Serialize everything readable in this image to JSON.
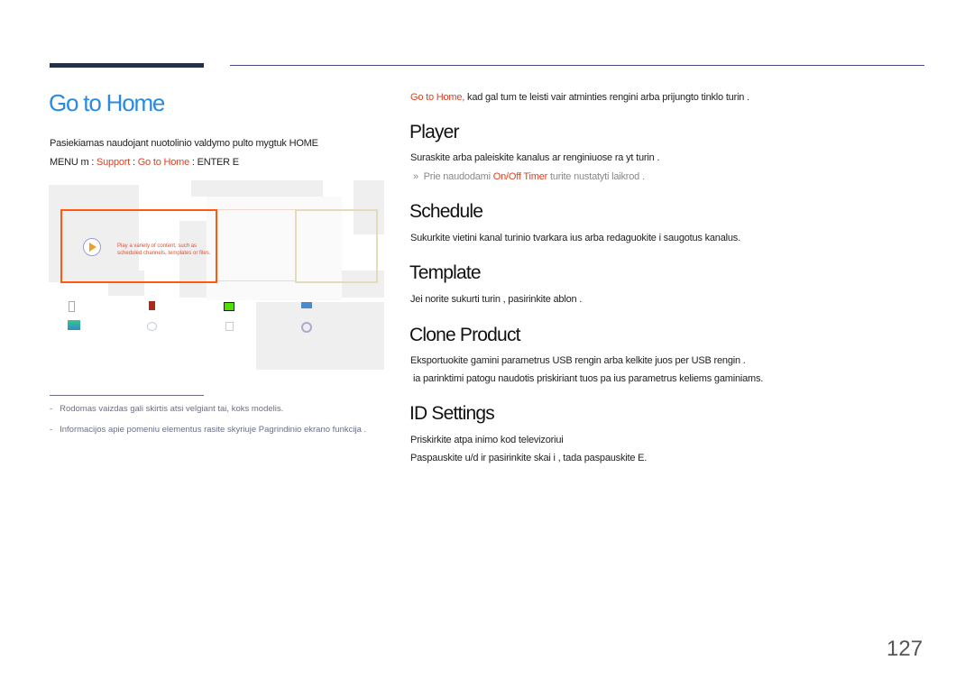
{
  "header": {
    "accent_color": "#233045",
    "rule_color": "#4a4a7a"
  },
  "left": {
    "title": "Go to Home",
    "line1": "Pasiekiamas naudojant nuotolinio valdymo pulto mygtuk  HOME",
    "menu_prefix": "MENU m  : ",
    "menu_support": "Support",
    "menu_sep": "  : ",
    "menu_home": "Go to Home",
    "menu_suffix": "  : ENTER E",
    "screen": {
      "player_desc_1": "Play a variety of content, such as",
      "player_desc_2": "scheduled channels, templates or files."
    },
    "notes": [
      "Rodomas vaizdas gali skirtis atsi velgiant   tai, koks modelis.",
      "Informacijos apie pomeniu elementus rasite skyriuje  Pagrindinio ekrano funkcija ."
    ]
  },
  "right": {
    "intro_link": "Go to Home,",
    "intro_text": " kad gal tum te leisti  vair  atminties  rengini  arba prijungto tinklo turin .",
    "sections": [
      {
        "title": "Player",
        "lines": [
          "Suraskite arba paleiskite kanalus ar  renginiuose  ra yt  turin ."
        ],
        "note_pre": "Prie  naudodami ",
        "note_link": "On/Off Timer",
        "note_post": " turite nustatyti laikrod ."
      },
      {
        "title": "Schedule",
        "lines": [
          "Sukurkite vietini  kanal  turinio tvarkara  ius arba redaguokite i saugotus kanalus."
        ]
      },
      {
        "title": "Template",
        "lines": [
          "Jei norite sukurti turin , pasirinkite  ablon ."
        ]
      },
      {
        "title": "Clone Product",
        "lines": [
          "Eksportuokite gamini  parametrus   USB  rengin  arba  kelkite juos per USB  rengin .",
          "ia parinktimi patogu naudotis priskiriant tuos pa ius parametrus keliems gaminiams."
        ]
      },
      {
        "title": "ID Settings",
        "lines": [
          "Priskirkite atpa inimo kod  televizoriui",
          "Paspauskite u/d ir pasirinkite skai i , tada paspauskite E."
        ]
      }
    ]
  },
  "page_number": "127"
}
